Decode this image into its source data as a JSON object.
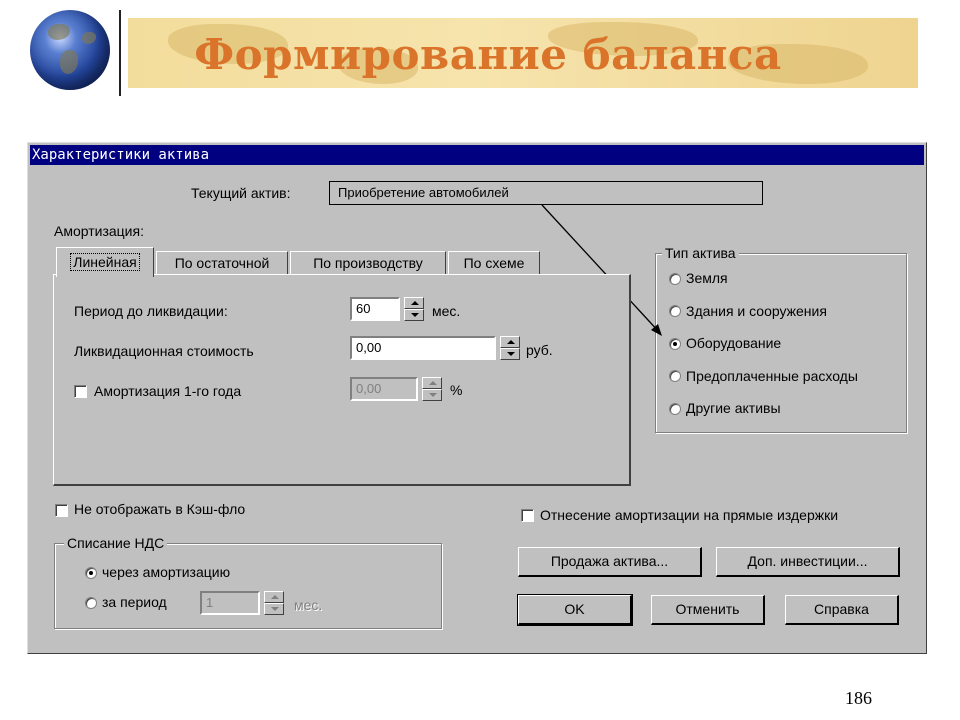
{
  "slide": {
    "title": "Формирование баланса",
    "page_number": "186"
  },
  "dialog": {
    "title": "Характеристики актива",
    "current_asset_label": "Текущий актив:",
    "current_asset_value": "Приобретение автомобилей",
    "amortization_label": "Амортизация:",
    "tabs": [
      {
        "label": "Линейная",
        "active": true
      },
      {
        "label": "По остаточной",
        "active": false
      },
      {
        "label": "По производству",
        "active": false
      },
      {
        "label": "По схеме",
        "active": false
      }
    ],
    "period_label": "Период до ликвидации:",
    "period_value": "60",
    "period_unit": "мес.",
    "liquidation_label": "Ликвидационная стоимость",
    "liquidation_value": "0,00",
    "liquidation_unit": "руб.",
    "first_year_label": "Амортизация 1-го года",
    "first_year_value": "0,00",
    "first_year_unit": "%",
    "first_year_checked": false,
    "asset_type": {
      "caption": "Тип актива",
      "options": [
        {
          "label": "Земля",
          "selected": false
        },
        {
          "label": "Здания и сооружения",
          "selected": false
        },
        {
          "label": "Оборудование",
          "selected": true
        },
        {
          "label": "Предоплаченные расходы",
          "selected": false
        },
        {
          "label": "Другие активы",
          "selected": false
        }
      ]
    },
    "no_cashflow_label": "Не отображать в Кэш-фло",
    "direct_costs_label": "Отнесение амортизации на прямые издержки",
    "vat": {
      "caption": "Списание НДС",
      "via_amortization_label": "через амортизацию",
      "per_period_label": "за период",
      "period_value": "1",
      "period_unit": "мес.",
      "selected": "via_amortization"
    },
    "buttons": {
      "sell": "Продажа актива...",
      "invest": "Доп. инвестиции...",
      "ok": "OK",
      "cancel": "Отменить",
      "help": "Справка"
    }
  }
}
